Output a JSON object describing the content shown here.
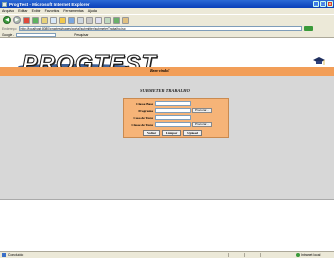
{
  "window": {
    "title": "ProgTest - Microsoft Internet Explorer",
    "minimize": "_",
    "maximize": "□",
    "close": "x"
  },
  "menu": [
    "Arquivo",
    "Editar",
    "Exibir",
    "Favoritos",
    "Ferramentas",
    "Ajuda"
  ],
  "toolbar": {
    "back": "◀",
    "forward": "▶"
  },
  "address": {
    "label": "Endereço",
    "url": "http://localhost:8080/progtest/pages/portal/submitter/submeterTrabalho.jsp"
  },
  "links": {
    "label": "Google -",
    "search": "Pesquisar"
  },
  "page": {
    "logo": "PROGTEST",
    "welcome": "Bem-vindo!",
    "form_title": "SUBMETER TRABALHO",
    "fields": [
      {
        "label": "Classe Base",
        "has_browse": false
      },
      {
        "label": "Programa",
        "has_browse": true
      },
      {
        "label": "Caso de Teste",
        "has_browse": false
      },
      {
        "label": "Classe de Teste",
        "has_browse": true
      }
    ],
    "browse_label": "Procurar...",
    "buttons": [
      "Voltar",
      "Limpar",
      "Upload"
    ]
  },
  "status": {
    "text": "Concluído",
    "zone": "Intranet local"
  }
}
